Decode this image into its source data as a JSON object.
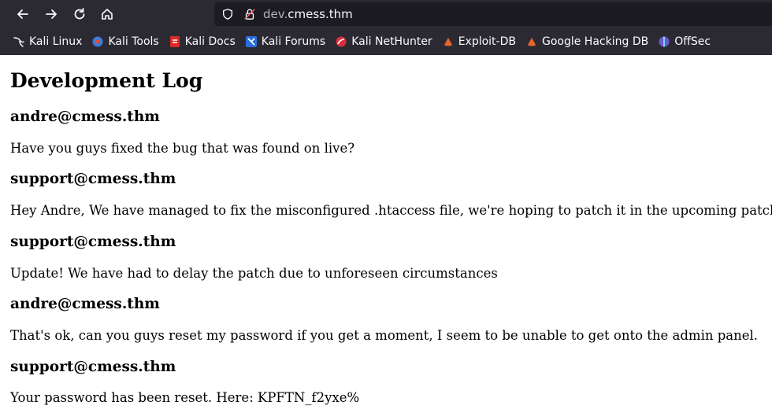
{
  "browser": {
    "url_prefix": "dev.",
    "url_domain": "cmess.thm",
    "bookmarks": [
      {
        "label": "Kali Linux",
        "icon": "kali-dragon-icon"
      },
      {
        "label": "Kali Tools",
        "icon": "kali-tools-icon"
      },
      {
        "label": "Kali Docs",
        "icon": "kali-docs-icon"
      },
      {
        "label": "Kali Forums",
        "icon": "kali-forums-icon"
      },
      {
        "label": "Kali NetHunter",
        "icon": "nethunter-icon"
      },
      {
        "label": "Exploit-DB",
        "icon": "exploit-db-icon"
      },
      {
        "label": "Google Hacking DB",
        "icon": "ghdb-icon"
      },
      {
        "label": "OffSec",
        "icon": "offsec-icon"
      }
    ]
  },
  "page": {
    "title": "Development Log",
    "entries": [
      {
        "author": "andre@cmess.thm",
        "message": "Have you guys fixed the bug that was found on live?"
      },
      {
        "author": "support@cmess.thm",
        "message": "Hey Andre, We have managed to fix the misconfigured .htaccess file, we're hoping to patch it in the upcoming patch!"
      },
      {
        "author": "support@cmess.thm",
        "message": "Update! We have had to delay the patch due to unforeseen circumstances"
      },
      {
        "author": "andre@cmess.thm",
        "message": "That's ok, can you guys reset my password if you get a moment, I seem to be unable to get onto the admin panel."
      },
      {
        "author": "support@cmess.thm",
        "message": "Your password has been reset. Here: KPFTN_f2yxe%"
      }
    ]
  }
}
